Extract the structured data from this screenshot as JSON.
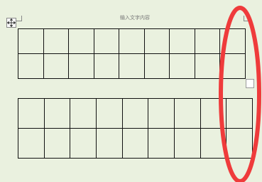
{
  "page": {
    "title_placeholder": "输入文字内容"
  },
  "tables": [
    {
      "rows": 2,
      "cols": 9
    },
    {
      "rows": 2,
      "cols": 9
    }
  ],
  "colors": {
    "background": "#eaf1df",
    "grid_line": "#111111",
    "annotation_circle": "#ef3b3b"
  },
  "icons": {
    "move_handle": "four-way-move-icon",
    "resize_handle": "table-resize-icon"
  }
}
